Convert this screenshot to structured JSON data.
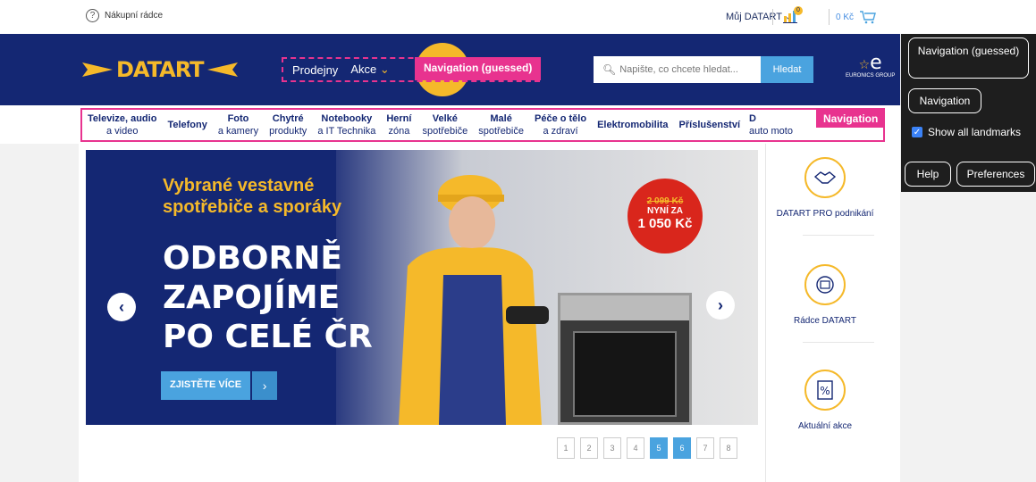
{
  "topbar": {
    "help_label": "Nákupní rádce",
    "account_label": "Můj DATART",
    "compare_count": "0",
    "cart_total": "0 Kč"
  },
  "header": {
    "logo_text": "DATART",
    "nav_items": [
      {
        "label": "Prodejny"
      },
      {
        "label": "Akce"
      }
    ],
    "nav_guessed_label": "Navigation (guessed)",
    "search_placeholder": "Napište, co chcete hledat...",
    "search_button": "Hledat",
    "partner_label": "EURONICS GROUP"
  },
  "categories": [
    {
      "line1": "Televize, audio",
      "line2": "a video"
    },
    {
      "line1": "Telefony",
      "line2": ""
    },
    {
      "line1": "Foto",
      "line2": "a kamery"
    },
    {
      "line1": "Chytré",
      "line2": "produkty"
    },
    {
      "line1": "Notebooky",
      "line2": "a IT Technika"
    },
    {
      "line1": "Herní",
      "line2": "zóna"
    },
    {
      "line1": "Velké",
      "line2": "spotřebiče"
    },
    {
      "line1": "Malé",
      "line2": "spotřebiče"
    },
    {
      "line1": "Péče o tělo",
      "line2": "a zdraví"
    },
    {
      "line1": "Elektromobilita",
      "line2": ""
    },
    {
      "line1": "Příslušenství",
      "line2": ""
    },
    {
      "line1": "D",
      "line2": "auto moto"
    }
  ],
  "nav_landmark_label": "Navigation",
  "banner": {
    "subtitle_line1": "Vybrané vestavné",
    "subtitle_line2": "spotřebiče a sporáky",
    "headline_line1": "ODBORNĚ",
    "headline_line2": "ZAPOJÍME",
    "headline_line3": "PO CELÉ ČR",
    "cta": "ZJISTĚTE VÍCE",
    "price_old": "2 099 Kč",
    "price_now_label": "NYNÍ ZA",
    "price_new": "1 050 Kč",
    "prev_icon": "‹",
    "next_icon": "›"
  },
  "pagination": {
    "pages": [
      "1",
      "2",
      "3",
      "4",
      "5",
      "6",
      "7",
      "8"
    ],
    "active": [
      "5",
      "6"
    ]
  },
  "side_links": [
    {
      "label": "DATART PRO podnikání",
      "icon": "handshake-icon"
    },
    {
      "label": "Rádce DATART",
      "icon": "guide-icon"
    },
    {
      "label": "Aktuální akce",
      "icon": "percent-icon"
    }
  ],
  "landmarks_panel": {
    "nav_guessed": "Navigation (guessed)",
    "nav": "Navigation",
    "show_all": "Show all landmarks",
    "help": "Help",
    "preferences": "Preferences"
  },
  "colors": {
    "brand_blue": "#142773",
    "brand_yellow": "#f5b92a",
    "accent_blue": "#4aa3df",
    "landmark_pink": "#e8338f"
  }
}
